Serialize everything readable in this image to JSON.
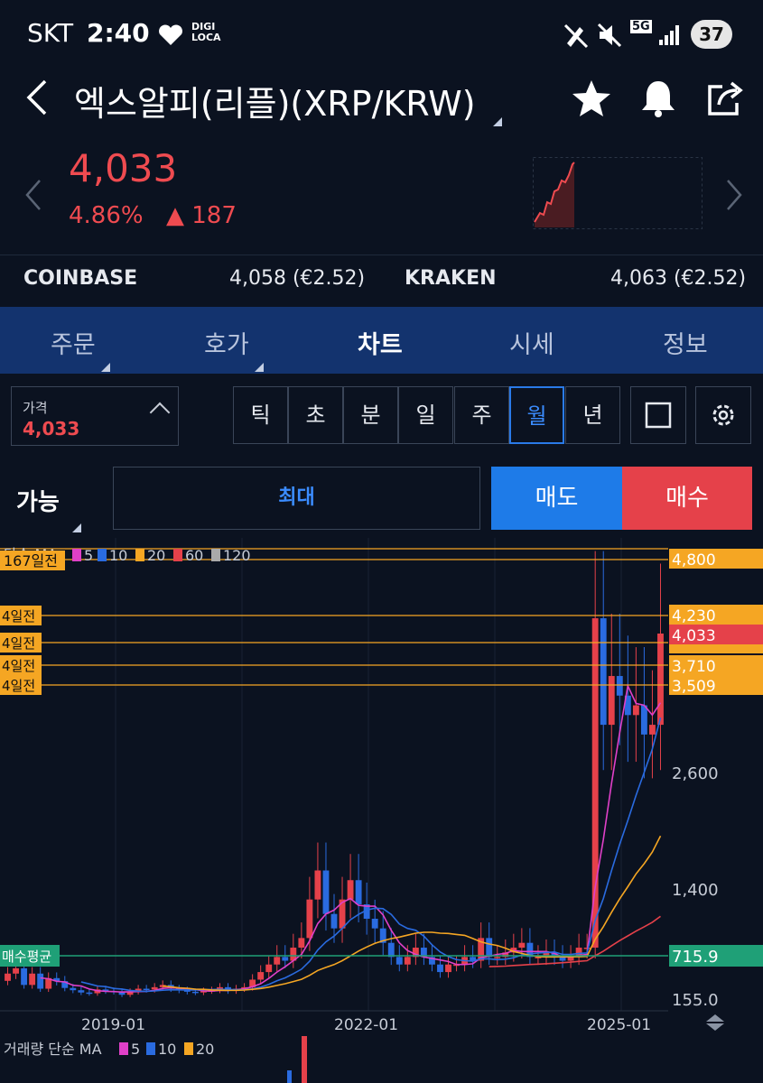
{
  "status": {
    "carrier": "SKT",
    "time": "2:40",
    "app_badge": "DIGI LOCA",
    "network": "5G",
    "battery": "37"
  },
  "header": {
    "title": "엑스알피(리플)(XRP/KRW)"
  },
  "quote": {
    "price": "4,033",
    "change_pct": "4.86%",
    "change_abs": "▲ 187"
  },
  "exchanges": [
    {
      "name": "COINBASE",
      "value": "4,058 (€2.52)"
    },
    {
      "name": "KRAKEN",
      "value": "4,063 (€2.52)"
    }
  ],
  "tabs": [
    {
      "label": "주문"
    },
    {
      "label": "호가"
    },
    {
      "label": "차트"
    },
    {
      "label": "시세"
    },
    {
      "label": "정보"
    }
  ],
  "price_box": {
    "label": "가격",
    "value": "4,033"
  },
  "periods": [
    "틱",
    "초",
    "분",
    "일",
    "주",
    "월",
    "년"
  ],
  "order": {
    "available": "가능",
    "max": "최대",
    "sell": "매도",
    "buy": "매수"
  },
  "colors": {
    "up": "#ef4b50",
    "down": "#1e7be8",
    "accent": "#f5a623",
    "tab_bg": "#13336e",
    "avg_line": "#1fa077"
  },
  "icons": [
    "back-arrow-icon",
    "star-icon",
    "bell-icon",
    "share-icon",
    "square-icon",
    "gear-icon",
    "chevron-left-icon",
    "chevron-right-icon"
  ],
  "chart_data": {
    "type": "candlestick",
    "legend": {
      "label": "단순 MA",
      "items": [
        "5",
        "10",
        "20",
        "60",
        "120"
      ]
    },
    "y_axis_labels": [
      "4,800",
      "4,230",
      "4,033",
      "3,710",
      "3,509",
      "2,600",
      "1,400",
      "715.9",
      "155.0"
    ],
    "x_axis_labels": [
      "2019-01",
      "2022-01",
      "2025-01"
    ],
    "levels": [
      {
        "tag": "167일전",
        "value": "4,800"
      },
      {
        "tag": "4일전",
        "value": "4,230"
      },
      {
        "tag": "4일전",
        "value": "4,033"
      },
      {
        "tag": "4일전",
        "value": "3,710"
      },
      {
        "tag": "4일전",
        "value": "3,509"
      }
    ],
    "avg_label": "매수평균",
    "avg_value": "715.9",
    "volume_legend": {
      "label": "거래량 단순 MA",
      "items": [
        "5",
        "10",
        "20"
      ]
    },
    "monthly_closes": [
      480,
      550,
      330,
      480,
      280,
      420,
      380,
      290,
      260,
      230,
      220,
      270,
      250,
      240,
      200,
      240,
      280,
      270,
      300,
      330,
      280,
      260,
      240,
      230,
      250,
      260,
      300,
      250,
      280,
      300,
      400,
      500,
      600,
      700,
      650,
      800,
      900,
      1300,
      1600,
      1150,
      1000,
      1300,
      1500,
      1250,
      1100,
      1000,
      850,
      700,
      600,
      700,
      800,
      700,
      600,
      500,
      600,
      600,
      700,
      650,
      900,
      700,
      700,
      750,
      800,
      850,
      700,
      700,
      750,
      700,
      650,
      700,
      800,
      800,
      4200,
      3100,
      3600,
      3400,
      3200,
      3300,
      3000,
      3100,
      4033
    ]
  }
}
